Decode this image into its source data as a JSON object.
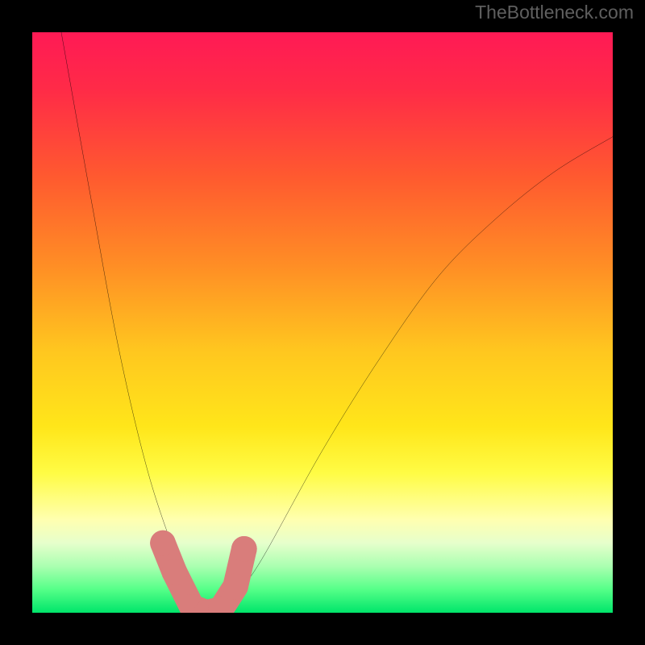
{
  "watermark": "TheBottleneck.com",
  "chart_data": {
    "type": "line",
    "title": "",
    "xlabel": "",
    "ylabel": "",
    "xlim": [
      0,
      100
    ],
    "ylim": [
      0,
      100
    ],
    "grid": false,
    "legend": false,
    "series": [
      {
        "name": "bottleneck-curve",
        "x": [
          5,
          10,
          15,
          20,
          25,
          27,
          29,
          30,
          32,
          34,
          36,
          40,
          50,
          60,
          70,
          80,
          90,
          100
        ],
        "y": [
          100,
          72,
          45,
          24,
          9,
          4,
          1,
          0,
          0,
          1,
          4,
          10,
          28,
          44,
          58,
          68,
          76,
          82
        ]
      }
    ],
    "markers": {
      "name": "highlighted-points",
      "x": [
        22.5,
        24.5,
        27.5,
        30,
        32.5,
        35,
        36.5
      ],
      "y": [
        12,
        7,
        1,
        0,
        0.6,
        4.5,
        11
      ],
      "color": "#d97d7b"
    },
    "background": "rainbow-gradient-vertical"
  }
}
